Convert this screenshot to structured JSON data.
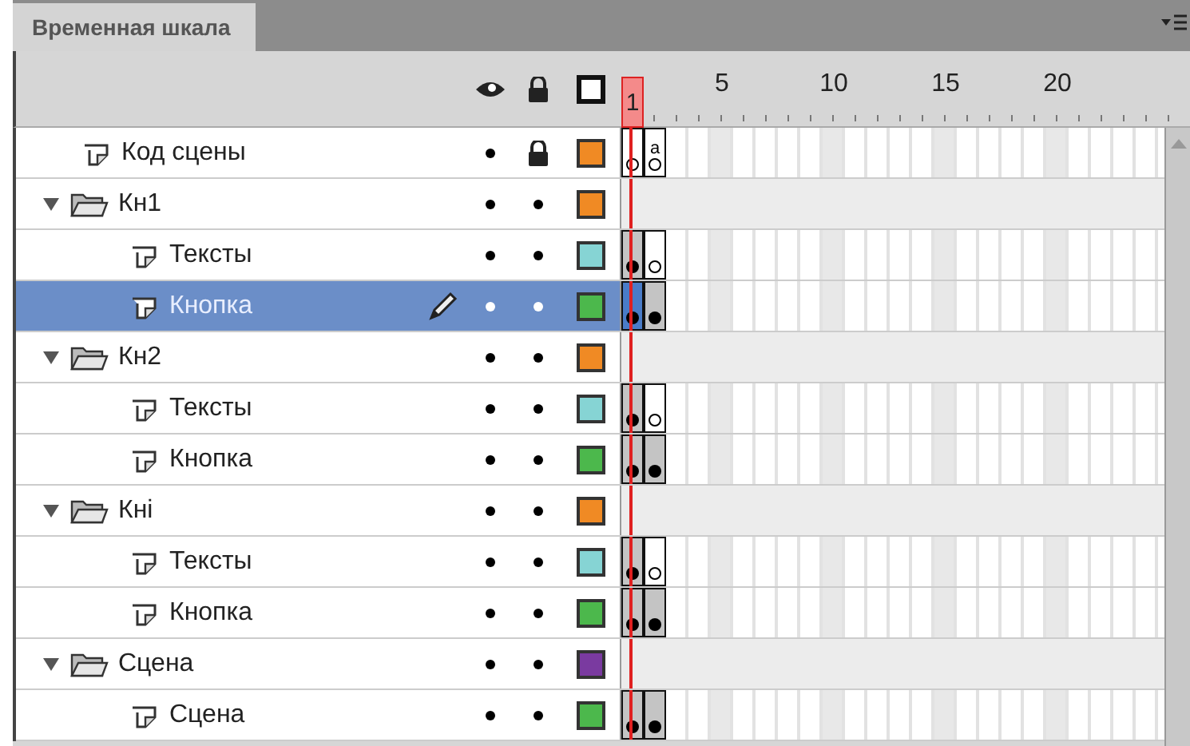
{
  "panel": {
    "tab": "Временная шкала"
  },
  "ruler": {
    "playhead": "1",
    "labels": [
      "5",
      "10",
      "15",
      "20"
    ]
  },
  "layers": [
    {
      "kind": "layer",
      "name": "Код сцены",
      "selected": false,
      "locked": true,
      "color": "#f08a24",
      "frames": [
        {
          "kind": "empty"
        },
        {
          "kind": "empty",
          "label": "a"
        }
      ]
    },
    {
      "kind": "folder",
      "name": "Кн1",
      "expanded": true,
      "selected": false,
      "locked": false,
      "color": "#f08a24",
      "children": [
        {
          "kind": "layer",
          "name": "Тексты",
          "selected": false,
          "locked": false,
          "color": "#86d4d4",
          "frames": [
            {
              "kind": "filled"
            },
            {
              "kind": "empty"
            }
          ]
        },
        {
          "kind": "layer",
          "name": "Кнопка",
          "selected": true,
          "locked": false,
          "color": "#4cb84c",
          "frames": [
            {
              "kind": "filled"
            },
            {
              "kind": "filled"
            }
          ]
        }
      ]
    },
    {
      "kind": "folder",
      "name": "Кн2",
      "expanded": true,
      "selected": false,
      "locked": false,
      "color": "#f08a24",
      "children": [
        {
          "kind": "layer",
          "name": "Тексты",
          "selected": false,
          "locked": false,
          "color": "#86d4d4",
          "frames": [
            {
              "kind": "filled"
            },
            {
              "kind": "empty"
            }
          ]
        },
        {
          "kind": "layer",
          "name": "Кнопка",
          "selected": false,
          "locked": false,
          "color": "#4cb84c",
          "frames": [
            {
              "kind": "filled"
            },
            {
              "kind": "filled"
            }
          ]
        }
      ]
    },
    {
      "kind": "folder",
      "name": "Кнi",
      "expanded": true,
      "selected": false,
      "locked": false,
      "color": "#f08a24",
      "children": [
        {
          "kind": "layer",
          "name": "Тексты",
          "selected": false,
          "locked": false,
          "color": "#86d4d4",
          "frames": [
            {
              "kind": "filled"
            },
            {
              "kind": "empty"
            }
          ]
        },
        {
          "kind": "layer",
          "name": "Кнопка",
          "selected": false,
          "locked": false,
          "color": "#4cb84c",
          "frames": [
            {
              "kind": "filled"
            },
            {
              "kind": "filled"
            }
          ]
        }
      ]
    },
    {
      "kind": "folder",
      "name": "Сцена",
      "expanded": true,
      "selected": false,
      "locked": false,
      "color": "#7a3aa0",
      "children": [
        {
          "kind": "layer",
          "name": "Сцена",
          "selected": false,
          "locked": false,
          "color": "#4cb84c",
          "frames": [
            {
              "kind": "filled"
            },
            {
              "kind": "filled"
            }
          ]
        }
      ]
    }
  ]
}
